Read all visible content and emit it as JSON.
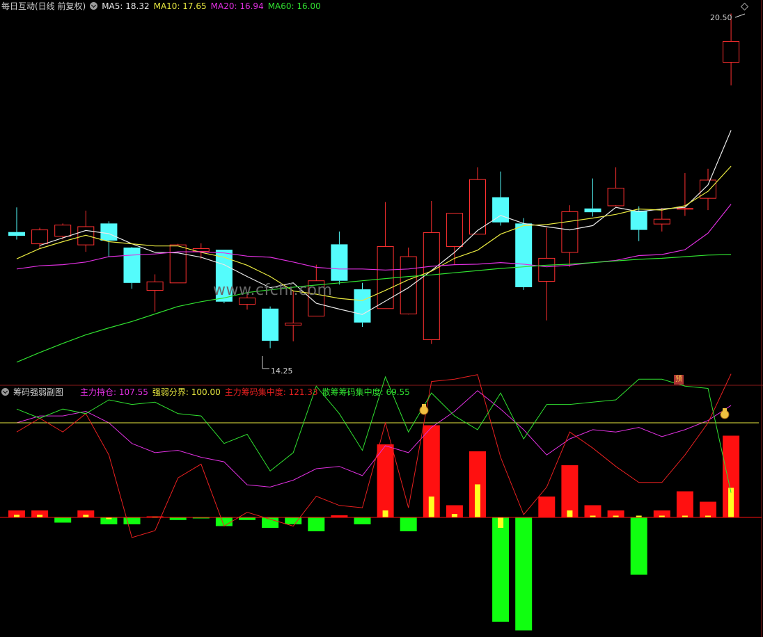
{
  "top_header": {
    "title": "每日互动(日线 前复权)",
    "ma5": "MA5: 18.32",
    "ma10": "MA10: 17.65",
    "ma20": "MA20: 16.94",
    "ma60": "MA60: 16.00"
  },
  "bottom_header": {
    "title": "筹码强弱副图",
    "main_hold": "主力持仓: 107.55",
    "strength_line": "强弱分界: 100.00",
    "main_conc": "主力筹码集中度: 121.33",
    "scatter_conc": "散筹筹码集中度: 69.55"
  },
  "annotations": {
    "high_label": "20.50",
    "low_label": "14.25",
    "forecast_icon": "预",
    "watermark": "www.cfchi.com"
  },
  "colors": {
    "up": "#ff3030",
    "down": "#54fcfc",
    "ma5": "#e8e8e8",
    "ma10": "#e8e840",
    "ma20": "#e030e0",
    "ma60": "#30e030",
    "hold": "#e030e0",
    "boundary": "#e8e840",
    "main_conc": "#e82020",
    "scatter_conc": "#30e030"
  },
  "chart_data": [
    {
      "type": "candlestick",
      "title": "每日互动(日线 前复权)",
      "x": [
        "1",
        "2",
        "3",
        "4",
        "5",
        "6",
        "7",
        "8",
        "9",
        "10",
        "11",
        "12",
        "13",
        "14",
        "15",
        "16",
        "17",
        "18",
        "19",
        "20",
        "21",
        "22",
        "23",
        "24",
        "25",
        "26",
        "27",
        "28",
        "29",
        "30",
        "31",
        "32"
      ],
      "ohlc": [
        [
          16.42,
          16.88,
          16.28,
          16.35
        ],
        [
          16.2,
          16.5,
          16.12,
          16.46
        ],
        [
          16.34,
          16.58,
          16.28,
          16.55
        ],
        [
          16.18,
          16.82,
          16.05,
          16.52
        ],
        [
          16.58,
          16.62,
          15.95,
          16.26
        ],
        [
          16.13,
          16.14,
          15.36,
          15.47
        ],
        [
          15.33,
          15.63,
          14.93,
          15.49
        ],
        [
          15.47,
          16.2,
          15.47,
          16.18
        ],
        [
          16.06,
          16.21,
          15.92,
          16.11
        ],
        [
          16.09,
          16.09,
          15.09,
          15.12
        ],
        [
          15.07,
          15.27,
          14.97,
          15.19
        ],
        [
          14.99,
          15.03,
          14.25,
          14.39
        ],
        [
          14.68,
          15.33,
          14.38,
          14.72
        ],
        [
          14.85,
          15.81,
          14.85,
          15.51
        ],
        [
          16.19,
          16.43,
          15.44,
          15.51
        ],
        [
          15.35,
          15.47,
          14.65,
          14.73
        ],
        [
          14.99,
          16.98,
          14.99,
          16.15
        ],
        [
          14.89,
          16.13,
          14.88,
          15.96
        ],
        [
          14.41,
          17.0,
          14.33,
          16.41
        ],
        [
          16.15,
          16.77,
          15.81,
          16.77
        ],
        [
          16.38,
          17.63,
          16.38,
          17.4
        ],
        [
          17.07,
          17.55,
          16.54,
          16.6
        ],
        [
          16.58,
          16.68,
          15.34,
          15.39
        ],
        [
          15.5,
          16.5,
          14.77,
          15.93
        ],
        [
          16.04,
          16.92,
          15.77,
          16.8
        ],
        [
          16.86,
          17.42,
          16.71,
          16.79
        ],
        [
          16.91,
          17.63,
          16.92,
          17.24
        ],
        [
          16.82,
          16.9,
          16.25,
          16.46
        ],
        [
          16.57,
          16.87,
          16.43,
          16.66
        ],
        [
          16.85,
          17.52,
          16.72,
          16.86
        ],
        [
          17.05,
          17.6,
          16.83,
          17.39
        ],
        [
          19.59,
          20.5,
          19.16,
          19.98
        ]
      ],
      "series": [
        {
          "name": "MA5",
          "values": [
            null,
            16.17,
            16.31,
            16.45,
            16.39,
            16.2,
            16.04,
            16.03,
            15.95,
            15.81,
            15.59,
            15.38,
            15.47,
            15.09,
            14.98,
            14.88,
            15.13,
            15.38,
            15.7,
            16.04,
            16.45,
            16.73,
            16.58,
            16.52,
            16.46,
            16.54,
            16.88,
            16.8,
            16.85,
            16.88,
            17.3,
            18.32
          ]
        },
        {
          "name": "MA10",
          "values": [
            15.92,
            16.11,
            16.24,
            16.36,
            16.24,
            16.2,
            16.16,
            16.16,
            16.04,
            15.95,
            15.8,
            15.59,
            15.32,
            15.26,
            15.18,
            15.14,
            15.33,
            15.53,
            15.69,
            15.93,
            16.08,
            16.38,
            16.54,
            16.56,
            16.62,
            16.68,
            16.75,
            16.85,
            16.83,
            16.91,
            17.18,
            17.65
          ]
        },
        {
          "name": "MA20",
          "values": [
            15.73,
            15.79,
            15.81,
            15.86,
            15.96,
            15.99,
            16.01,
            16.05,
            16.05,
            16.03,
            15.97,
            15.95,
            15.86,
            15.76,
            15.73,
            15.73,
            15.71,
            15.73,
            15.78,
            15.81,
            15.82,
            15.85,
            15.82,
            15.77,
            15.8,
            15.85,
            15.89,
            15.98,
            16.0,
            16.09,
            16.4,
            16.94
          ]
        },
        {
          "name": "MA60",
          "values": [
            13.99,
            14.17,
            14.34,
            14.5,
            14.63,
            14.75,
            14.89,
            15.03,
            15.12,
            15.19,
            15.29,
            15.34,
            15.39,
            15.43,
            15.47,
            15.51,
            15.55,
            15.59,
            15.62,
            15.66,
            15.7,
            15.74,
            15.77,
            15.8,
            15.82,
            15.85,
            15.88,
            15.91,
            15.93,
            15.96,
            15.99,
            16.0
          ]
        }
      ]
    },
    {
      "type": "bar",
      "title": "筹码强弱副图",
      "x": [
        "1",
        "2",
        "3",
        "4",
        "5",
        "6",
        "7",
        "8",
        "9",
        "10",
        "11",
        "12",
        "13",
        "14",
        "15",
        "16",
        "17",
        "18",
        "19",
        "20",
        "21",
        "22",
        "23",
        "24",
        "25",
        "26",
        "27",
        "28",
        "29",
        "30",
        "31",
        "32"
      ],
      "bars": [
        4,
        4,
        -3,
        4,
        -4,
        -4,
        0.6,
        -1.5,
        -0.6,
        -5,
        -1.5,
        -6,
        -4,
        -8,
        1.2,
        -4,
        42,
        -8,
        53,
        7,
        38,
        -60,
        -65,
        12,
        30,
        7,
        4,
        -33,
        4,
        15,
        9,
        47
      ],
      "inner_bars": [
        1.5,
        1.5,
        0,
        1.5,
        -1,
        0,
        0.4,
        0,
        0,
        0,
        0,
        0,
        0,
        0,
        0,
        0,
        4,
        0,
        12,
        2,
        19,
        -6,
        0,
        0,
        4,
        1,
        1,
        1,
        1,
        1,
        1,
        17
      ],
      "series": [
        {
          "name": "主力持仓",
          "values": [
            100,
            103,
            103,
            105,
            100,
            91,
            87,
            88,
            85,
            83,
            73,
            72,
            75,
            80,
            81,
            77,
            90,
            87,
            98,
            105,
            114,
            106,
            97,
            86,
            93,
            97,
            96,
            98,
            94,
            97,
            101,
            107.55
          ]
        },
        {
          "name": "强弱分界",
          "values": [
            100,
            100,
            100,
            100,
            100,
            100,
            100,
            100,
            100,
            100,
            100,
            100,
            100,
            100,
            100,
            100,
            100,
            100,
            100,
            100,
            100,
            100,
            100,
            100,
            100,
            100,
            100,
            100,
            100,
            100,
            100,
            100
          ]
        },
        {
          "name": "主力筹码集中度",
          "values": [
            96,
            102,
            96,
            104,
            86,
            50,
            53,
            76,
            82,
            55,
            61,
            58,
            55,
            68,
            64,
            63,
            100,
            63,
            118,
            119,
            121,
            85,
            60,
            72,
            96,
            89,
            81,
            74,
            74,
            86,
            100,
            121.33
          ]
        },
        {
          "name": "散筹筹码集中度",
          "values": [
            106,
            102,
            106,
            104,
            110,
            108,
            109,
            104,
            103,
            91,
            95,
            79,
            87,
            116,
            104,
            88,
            120,
            96,
            113,
            103,
            97,
            113,
            93,
            108,
            108,
            109,
            110,
            119,
            119,
            116,
            115,
            69.55
          ]
        }
      ]
    }
  ]
}
